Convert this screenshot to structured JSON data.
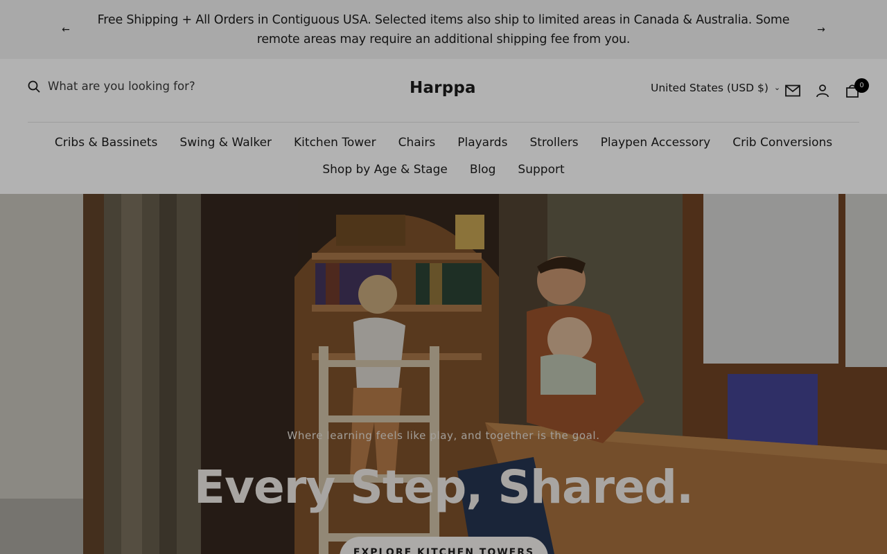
{
  "announcement": {
    "text": "Free Shipping + All Orders in Contiguous USA. Selected items also ship to limited areas in Canada & Australia. Some remote areas may require an additional shipping fee from you.",
    "prev_icon": "arrow-left-icon",
    "next_icon": "arrow-right-icon"
  },
  "header": {
    "search_placeholder": "What are you looking for?",
    "logo": "Harppa",
    "currency": "United States (USD $)",
    "cart_count": "0"
  },
  "nav": {
    "row1": [
      "Cribs & Bassinets",
      "Swing & Walker",
      "Kitchen Tower",
      "Chairs",
      "Playards",
      "Strollers",
      "Playpen Accessory",
      "Crib Conversions"
    ],
    "row2": [
      "Shop by Age & Stage",
      "Blog",
      "Support"
    ]
  },
  "hero": {
    "subtitle": "Where learning feels like play, and together is the goal.",
    "title": "Every Step, Shared.",
    "button": "EXPLORE KITCHEN TOWERS"
  }
}
